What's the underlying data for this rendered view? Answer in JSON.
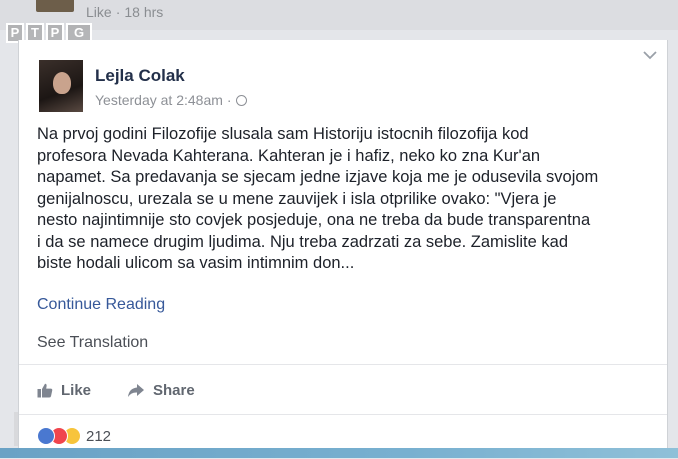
{
  "previous_post": {
    "like_label": "Like",
    "time": "18 hrs"
  },
  "watermark": {
    "letters": [
      "P",
      "T",
      "P",
      "G"
    ]
  },
  "post": {
    "author": "Lejla Colak",
    "timestamp": "Yesterday at 2:48am",
    "privacy_icon": "globe-icon",
    "text": "Na prvoj godini Filozofije slusala sam Historiju istocnih filozofija kod\nprofesora Nevada Kahterana. Kahteran je i hafiz, neko ko zna Kur'an\nnapamet. Sa predavanja se sjecam jedne izjave koja me je odusevila svojom\ngenijalnoscu, urezala se u mene zauvijek i isla otprilike ovako: \"Vjera je\nnesto najintimnije sto covjek posjeduje, ona ne treba da bude transparentna\ni da se namece drugim ljudima. Nju treba zadrzati za sebe. Zamislite kad\nbiste hodali ulicom sa vasim intimnim don...",
    "continue_label": "Continue Reading",
    "translate_label": "See Translation"
  },
  "actions": {
    "like_label": "Like",
    "share_label": "Share"
  },
  "reactions": {
    "types": [
      "like",
      "love",
      "sad"
    ],
    "count": "212"
  },
  "colors": {
    "link": "#365899",
    "author": "#23304a",
    "like_blue": "#4a78d0",
    "love_red": "#f0454d",
    "sad_yellow": "#f7c43b"
  }
}
